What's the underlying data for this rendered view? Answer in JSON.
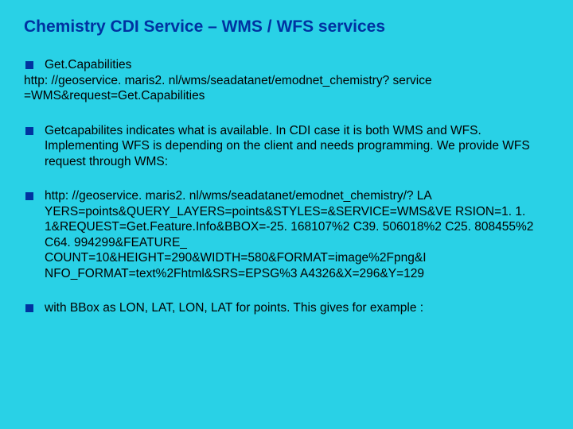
{
  "title": "Chemistry CDI Service – WMS / WFS services",
  "items": [
    {
      "lead": "Get.Capabilities",
      "cont": "http: //geoservice. maris2. nl/wms/seadatanet/emodnet_chemistry? service =WMS&request=Get.Capabilities"
    },
    {
      "lead": "Getcapabilites indicates what is available. In CDI case it is both WMS and WFS. Implementing WFS is depending on the client and needs programming. We provide WFS request through WMS:"
    },
    {
      "lead": "http: //geoservice. maris2. nl/wms/seadatanet/emodnet_chemistry/? LA YERS=points&QUERY_LAYERS=points&STYLES=&SERVICE=WMS&VE RSION=1. 1. 1&REQUEST=Get.Feature.Info&BBOX=-25. 168107%2 C39. 506018%2 C25. 808455%2 C64. 994299&FEATURE_ COUNT=10&HEIGHT=290&WIDTH=580&FORMAT=image%2Fpng&I NFO_FORMAT=text%2Fhtml&SRS=EPSG%3 A4326&X=296&Y=129"
    },
    {
      "lead": "with BBox as LON, LAT, LON, LAT for points. This gives for example  :"
    }
  ]
}
